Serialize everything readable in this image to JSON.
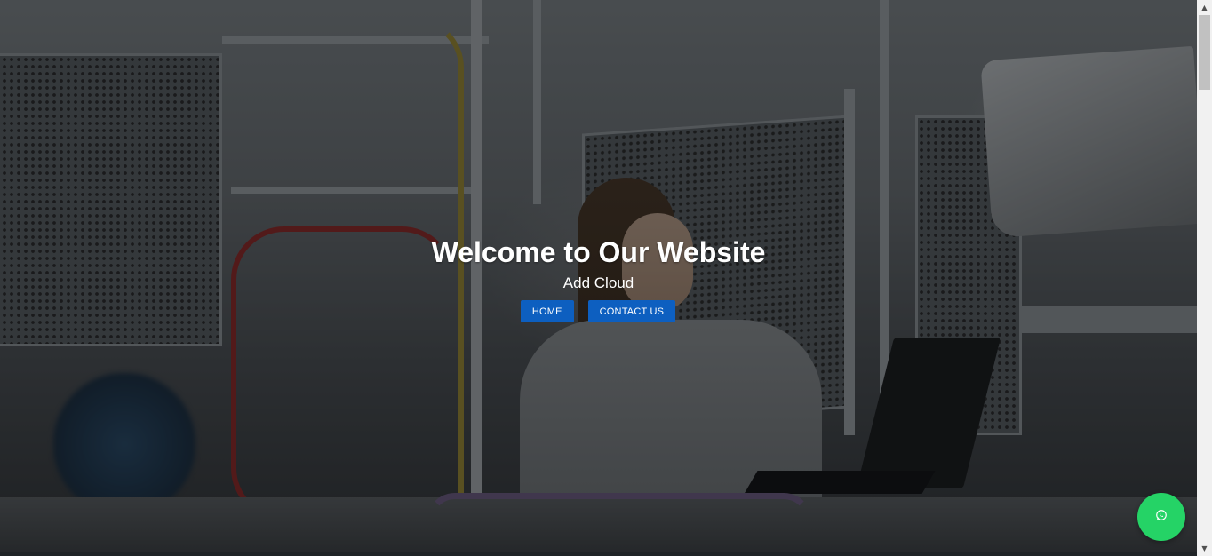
{
  "hero": {
    "title": "Welcome to Our Website",
    "subtitle": "Add Cloud",
    "buttons": {
      "home_label": "HOME",
      "contact_label": "CONTACT US"
    },
    "background_image": "woman working on laptop in electronics lab"
  },
  "floating": {
    "whatsapp_icon": "whatsapp-icon"
  },
  "scrollbar": {
    "up_icon": "scroll-up-arrow-icon",
    "down_icon": "scroll-down-arrow-icon"
  },
  "colors": {
    "button_blue": "#0d5fc0",
    "whatsapp_green": "#25d366",
    "hero_text": "#ffffff"
  }
}
